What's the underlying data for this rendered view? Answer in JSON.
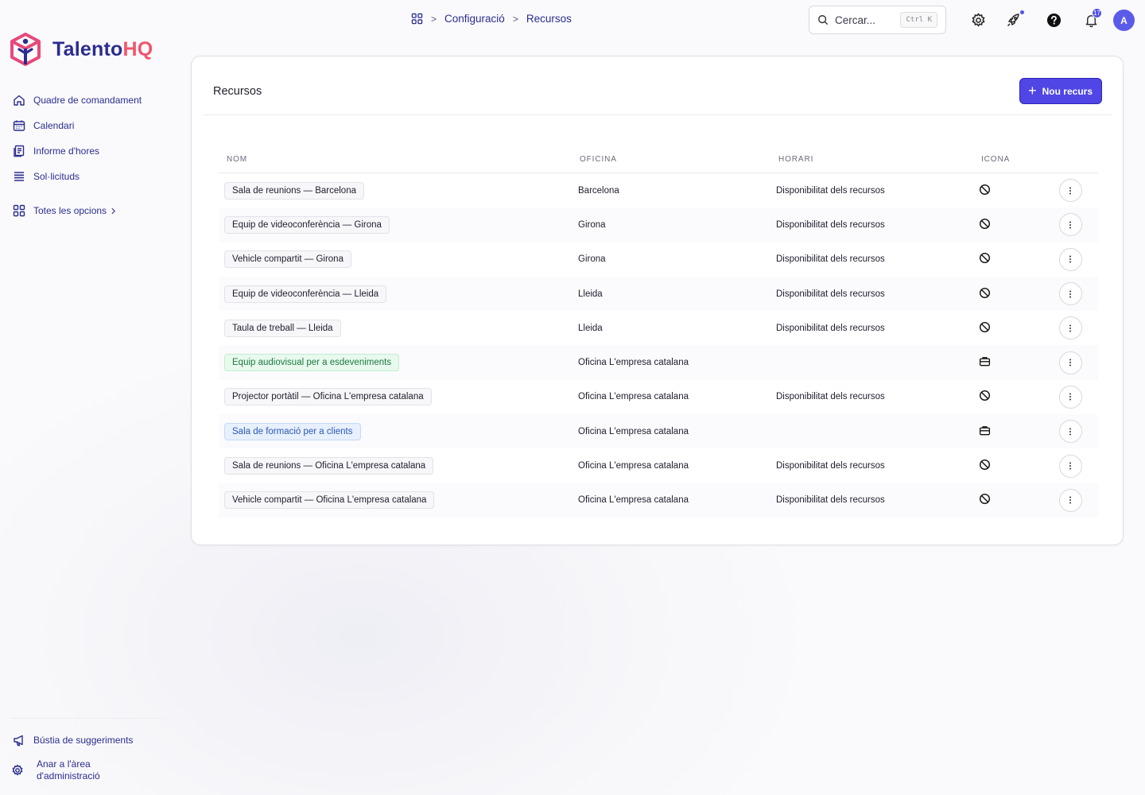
{
  "brand": {
    "word1": "Talento",
    "word2": "HQ"
  },
  "sidebar": {
    "items": [
      {
        "label": "Quadre de comandament",
        "icon": "home-icon"
      },
      {
        "label": "Calendari",
        "icon": "calendar-icon"
      },
      {
        "label": "Informe d'hores",
        "icon": "report-icon"
      },
      {
        "label": "Sol·licituds",
        "icon": "list-icon"
      }
    ],
    "all_options": "Totes les opcions",
    "footer": {
      "suggestions": "Bústia de suggeriments",
      "admin_line1": "Anar a l'àrea",
      "admin_line2": "d'administració"
    }
  },
  "header": {
    "breadcrumb": [
      "Configuració",
      "Recursos"
    ],
    "search_placeholder": "Cercar...",
    "search_shortcut": "Ctrl K",
    "notification_count": "17",
    "avatar_initial": "A"
  },
  "page": {
    "title": "Recursos",
    "new_button": "Nou recurs",
    "columns": [
      "NOM",
      "OFICINA",
      "HORARI",
      "ICONA"
    ],
    "rows": [
      {
        "name": "Sala de reunions — Barcelona",
        "office": "Barcelona",
        "schedule": "Disponibilitat dels recursos",
        "icon": "ban-icon",
        "tag": "default"
      },
      {
        "name": "Equip de videoconferència — Girona",
        "office": "Girona",
        "schedule": "Disponibilitat dels recursos",
        "icon": "ban-icon",
        "tag": "default"
      },
      {
        "name": "Vehicle compartit — Girona",
        "office": "Girona",
        "schedule": "Disponibilitat dels recursos",
        "icon": "ban-icon",
        "tag": "default"
      },
      {
        "name": "Equip de videoconferència — Lleida",
        "office": "Lleida",
        "schedule": "Disponibilitat dels recursos",
        "icon": "ban-icon",
        "tag": "default"
      },
      {
        "name": "Taula de treball — Lleida",
        "office": "Lleida",
        "schedule": "Disponibilitat dels recursos",
        "icon": "ban-icon",
        "tag": "default"
      },
      {
        "name": "Equip audiovisual per a esdeveniments",
        "office": "Oficina L'empresa catalana",
        "schedule": "",
        "icon": "briefcase-icon",
        "tag": "green"
      },
      {
        "name": "Projector portàtil — Oficina L'empresa catalana",
        "office": "Oficina L'empresa catalana",
        "schedule": "Disponibilitat dels recursos",
        "icon": "ban-icon",
        "tag": "default"
      },
      {
        "name": "Sala de formació per a clients",
        "office": "Oficina L'empresa catalana",
        "schedule": "",
        "icon": "briefcase-icon",
        "tag": "blue"
      },
      {
        "name": "Sala de reunions — Oficina L'empresa catalana",
        "office": "Oficina L'empresa catalana",
        "schedule": "Disponibilitat dels recursos",
        "icon": "ban-icon",
        "tag": "default"
      },
      {
        "name": "Vehicle compartit — Oficina L'empresa catalana",
        "office": "Oficina L'empresa catalana",
        "schedule": "Disponibilitat dels recursos",
        "icon": "ban-icon",
        "tag": "default"
      }
    ]
  },
  "colors": {
    "accent": "#4f46e5",
    "nav_text": "#2b2d8f",
    "brand_pink": "#f0566c"
  }
}
